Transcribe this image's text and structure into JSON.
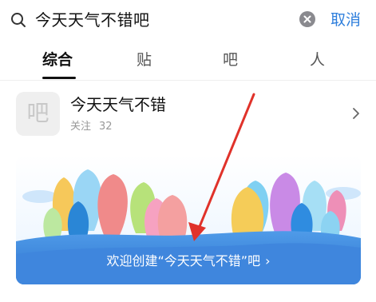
{
  "search": {
    "query": "今天天气不错吧",
    "cancel_label": "取消"
  },
  "tabs": [
    {
      "label": "综合",
      "active": true
    },
    {
      "label": "贴",
      "active": false
    },
    {
      "label": "吧",
      "active": false
    },
    {
      "label": "人",
      "active": false
    }
  ],
  "result": {
    "avatar_char": "吧",
    "name": "今天天气不错",
    "follow_label": "关注",
    "follow_count": "32"
  },
  "banner": {
    "label": "欢迎创建“今天天气不错”吧",
    "arrow": "›"
  },
  "icons": {
    "search": "search-icon",
    "clear": "close-circle-icon",
    "chevron": "chevron-right-icon",
    "annotation": "red-arrow-annotation"
  },
  "colors": {
    "accent": "#2f7fdc",
    "annotation": "#e0322a"
  }
}
